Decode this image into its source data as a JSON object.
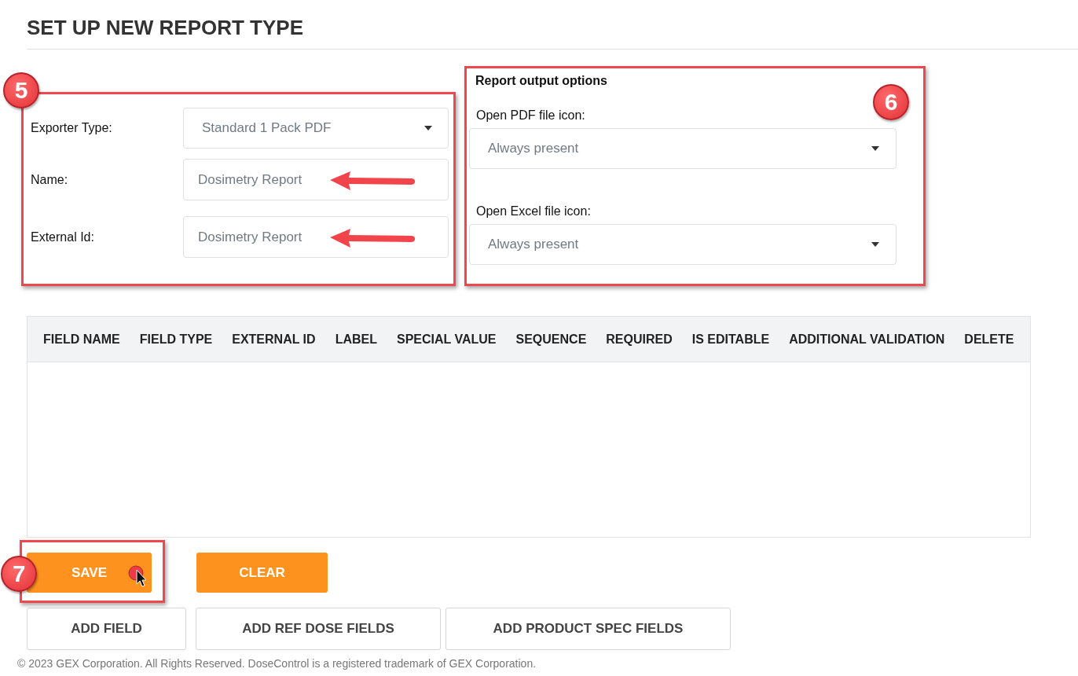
{
  "page": {
    "title": "SET UP NEW REPORT TYPE"
  },
  "report_settings": {
    "callout": "5",
    "fields": [
      {
        "kind": "select",
        "label": "Exporter Type:",
        "value": "Standard 1 Pack PDF",
        "highlighted": false
      },
      {
        "kind": "text",
        "label": "Name:",
        "value": "Dosimetry Report",
        "highlighted": true
      },
      {
        "kind": "text",
        "label": "External Id:",
        "value": "Dosimetry Report",
        "highlighted": true
      }
    ]
  },
  "output_options": {
    "callout": "6",
    "title": "Report output options",
    "fields": [
      {
        "label": "Open PDF file icon:",
        "value": "Always present"
      },
      {
        "label": "Open Excel file icon:",
        "value": "Always present"
      }
    ]
  },
  "table": {
    "columns": [
      "FIELD NAME",
      "FIELD TYPE",
      "EXTERNAL ID",
      "LABEL",
      "SPECIAL VALUE",
      "SEQUENCE",
      "REQUIRED",
      "IS EDITABLE",
      "ADDITIONAL VALIDATION",
      "DELETE"
    ]
  },
  "actions": {
    "callout": "7",
    "primary": [
      {
        "label": "SAVE",
        "highlighted": true
      },
      {
        "label": "CLEAR",
        "highlighted": false
      }
    ],
    "secondary": [
      "ADD FIELD",
      "ADD REF DOSE FIELDS",
      "ADD PRODUCT SPEC FIELDS"
    ]
  },
  "footer": "© 2023 GEX Corporation. All Rights Reserved. DoseControl is a registered trademark of GEX Corporation."
}
